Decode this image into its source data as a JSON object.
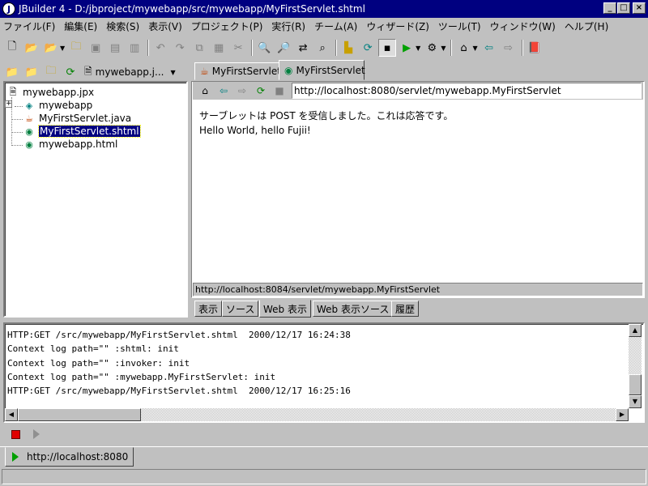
{
  "window": {
    "title": "JBuilder 4 - D:/jbproject/mywebapp/src/mywebapp/MyFirstServlet.shtml",
    "controls": [
      "_",
      "□",
      "×"
    ]
  },
  "menu": [
    "ファイル(F)",
    "編集(E)",
    "検索(S)",
    "表示(V)",
    "プロジェクト(P)",
    "実行(R)",
    "チーム(A)",
    "ウィザード(Z)",
    "ツール(T)",
    "ウィンドウ(W)",
    "ヘルプ(H)"
  ],
  "toolbar": {
    "icons": [
      "new-file-icon",
      "open-file-icon",
      "reopen-icon",
      "close-file-icon",
      "save-icon",
      "save-all-icon",
      "print-icon",
      "undo-icon",
      "redo-icon",
      "copy-icon",
      "paste-icon",
      "cut-icon",
      "find-icon",
      "find-again-icon",
      "replace-icon",
      "search-path-icon",
      "make-icon",
      "rebuild-icon",
      "project-properties-icon",
      "run-icon",
      "debug-icon",
      "home-icon",
      "back-icon",
      "forward-icon",
      "help-book-icon"
    ]
  },
  "project": {
    "combo_label": "mywebapp.j...",
    "tree": [
      {
        "label": "mywebapp.jpx",
        "icon": "project-icon",
        "depth": 0
      },
      {
        "label": "mywebapp",
        "icon": "package-icon",
        "depth": 1
      },
      {
        "label": "MyFirstServlet.java",
        "icon": "java-file-icon",
        "depth": 1
      },
      {
        "label": "MyFirstServlet.shtml",
        "icon": "shtml-file-icon",
        "depth": 1,
        "selected": true
      },
      {
        "label": "mywebapp.html",
        "icon": "html-file-icon",
        "depth": 1
      }
    ]
  },
  "editor": {
    "tabs": [
      {
        "label": "MyFirstServlet",
        "active": false
      },
      {
        "label": "MyFirstServlet",
        "active": true
      }
    ],
    "url": "http://localhost:8080/servlet/mywebapp.MyFirstServlet",
    "content_lines": [
      "サーブレットは POST を受信しました。これは応答です。",
      "Hello World, hello Fujii!"
    ],
    "status_url": "http://localhost:8084/servlet/mywebapp.MyFirstServlet",
    "view_tabs": [
      {
        "label": "表示",
        "active": false
      },
      {
        "label": "ソース",
        "active": false
      },
      {
        "label": "Web 表示",
        "active": true
      },
      {
        "label": "Web 表示ソース",
        "active": false
      },
      {
        "label": "履歴",
        "active": false
      }
    ]
  },
  "log": {
    "lines": [
      "HTTP:GET /src/mywebapp/MyFirstServlet.shtml  2000/12/17 16:24:38",
      "Context log path=\"\" :shtml: init",
      "Context log path=\"\" :invoker: init",
      "Context log path=\"\" :mywebapp.MyFirstServlet: init",
      "HTTP:GET /src/mywebapp/MyFirstServlet.shtml  2000/12/17 16:25:16"
    ]
  },
  "run": {
    "tab_label": "http://localhost:8080"
  }
}
